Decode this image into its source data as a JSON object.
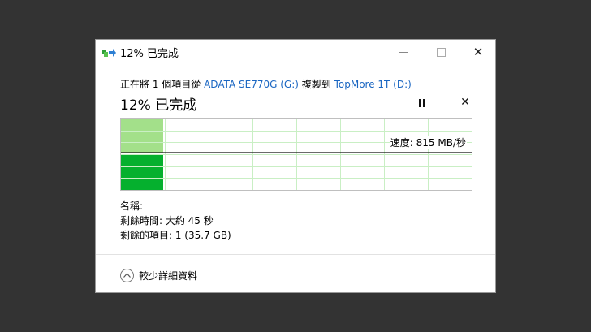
{
  "window": {
    "title": "12% 已完成",
    "controls": {
      "minimize": "",
      "maximize": "",
      "close": "✕"
    }
  },
  "copy": {
    "prefix": "正在將 1 個項目從 ",
    "source": "ADATA SE770G (G:)",
    "middle": " 複製到 ",
    "destination": "TopMore 1T (D:)",
    "progress_text": "12% 已完成",
    "progress_fraction": 0.12
  },
  "graph": {
    "speed_label": "速度: 815 MB/秒",
    "colors": {
      "history_fill": "#a3e08a",
      "current_fill": "#05b02e",
      "grid": "#c9efc4",
      "speed_line": "#111111"
    }
  },
  "details": {
    "name_label": "名稱:",
    "time_remaining": "剩餘時間: 大約 45 秒",
    "items_remaining": "剩餘的項目: 1 (35.7 GB)"
  },
  "footer": {
    "less_details_label": "較少詳細資料",
    "less_details_icon": "chevron-up-icon"
  }
}
